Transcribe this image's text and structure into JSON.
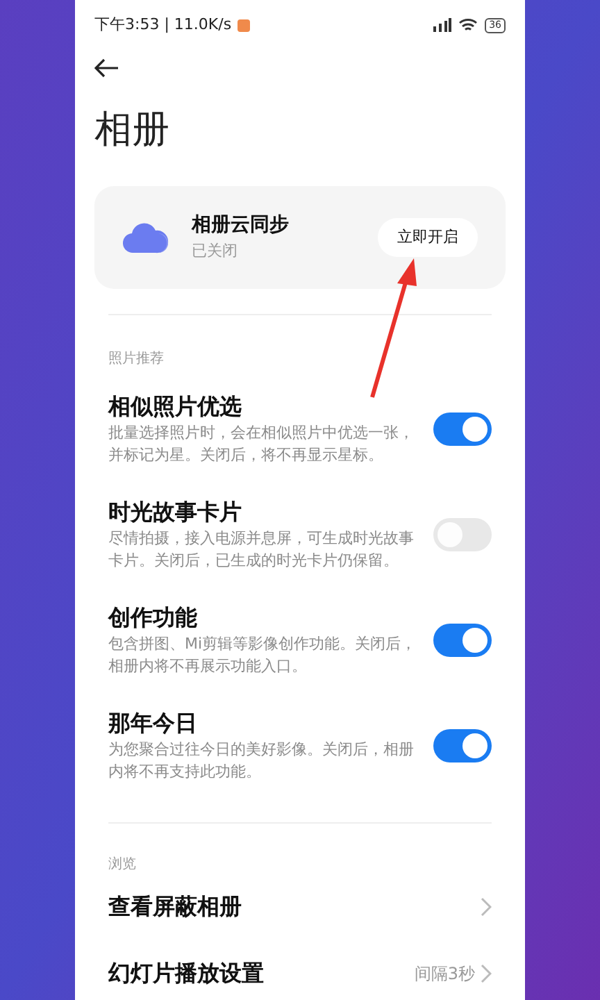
{
  "status_bar": {
    "time": "下午3:53 | 11.0K/s",
    "battery": "36"
  },
  "title": "相册",
  "cloud_card": {
    "title": "相册云同步",
    "status": "已关闭",
    "button": "立即开启"
  },
  "sections": [
    {
      "label": "照片推荐",
      "items": [
        {
          "kind": "toggle",
          "title": "相似照片优选",
          "description": "批量选择照片时，会在相似照片中优选一张，并标记为星。关闭后，将不再显示星标。",
          "on": true
        },
        {
          "kind": "toggle",
          "title": "时光故事卡片",
          "description": "尽情拍摄，接入电源并息屏，可生成时光故事卡片。关闭后，已生成的时光卡片仍保留。",
          "on": false
        },
        {
          "kind": "toggle",
          "title": "创作功能",
          "description": "包含拼图、Mi剪辑等影像创作功能。关闭后，相册内将不再展示功能入口。",
          "on": true
        },
        {
          "kind": "toggle",
          "title": "那年今日",
          "description": "为您聚合过往今日的美好影像。关闭后，相册内将不再支持此功能。",
          "on": true
        }
      ]
    },
    {
      "label": "浏览",
      "items": [
        {
          "kind": "link",
          "title": "查看屏蔽相册"
        },
        {
          "kind": "link",
          "title": "幻灯片播放设置",
          "value": "间隔3秒"
        }
      ]
    }
  ]
}
